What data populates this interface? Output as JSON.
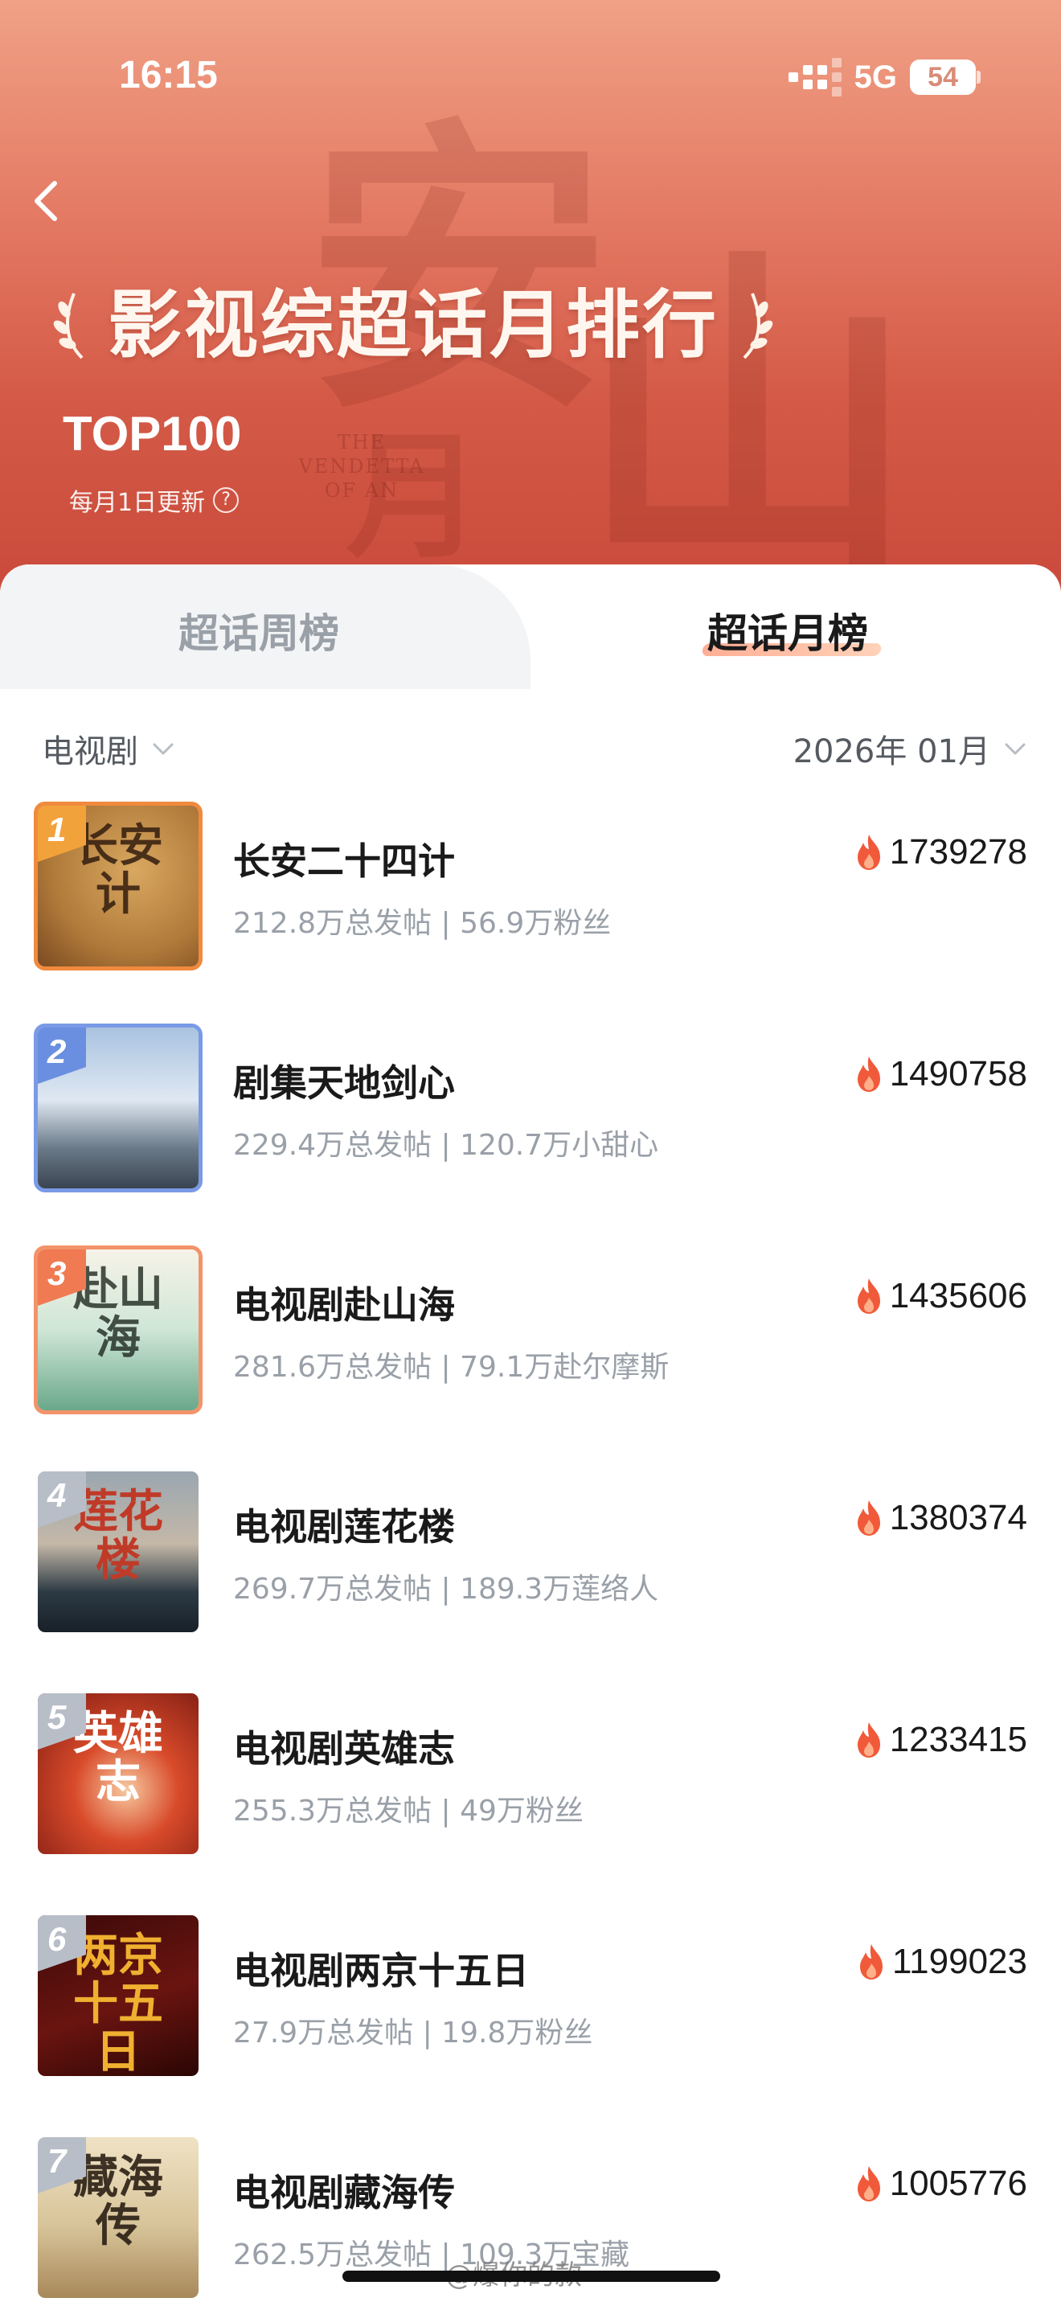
{
  "status_bar": {
    "time": "16:15",
    "network": "5G",
    "battery": "54"
  },
  "header": {
    "title": "影视综超话月排行",
    "top_label": "TOP100",
    "update_note": "每月1日更新",
    "background_glyphs": [
      "安",
      "山",
      "月"
    ],
    "background_text": "THE VENDETTA OF AN"
  },
  "tabs": [
    {
      "label": "超话周榜",
      "active": false
    },
    {
      "label": "超话月榜",
      "active": true
    }
  ],
  "filters": {
    "category": "电视剧",
    "period": "2026年 01月"
  },
  "list": [
    {
      "rank": "1",
      "name": "长安二十四计",
      "stats": "212.8万总发帖 | 56.9万粉丝",
      "score": "1739278",
      "poster_text": "长安计",
      "badge_color": "#f2a23a",
      "border_color": "#f08a3e"
    },
    {
      "rank": "2",
      "name": "剧集天地剑心",
      "stats": "229.4万总发帖 | 120.7万小甜心",
      "score": "1490758",
      "poster_text": "",
      "badge_color": "#6a8fe0",
      "border_color": "#7a9ae6"
    },
    {
      "rank": "3",
      "name": "电视剧赴山海",
      "stats": "281.6万总发帖 | 79.1万赴尔摩斯",
      "score": "1435606",
      "poster_text": "赴山海",
      "badge_color": "#f07a52",
      "border_color": "#f3936a"
    },
    {
      "rank": "4",
      "name": "电视剧莲花楼",
      "stats": "269.7万总发帖 | 189.3万莲络人",
      "score": "1380374",
      "poster_text": "莲花楼",
      "badge_color": "#b8bec8",
      "border_color": "#ffffff"
    },
    {
      "rank": "5",
      "name": "电视剧英雄志",
      "stats": "255.3万总发帖 | 49万粉丝",
      "score": "1233415",
      "poster_text": "英雄志",
      "badge_color": "#b8bec8",
      "border_color": "#ffffff"
    },
    {
      "rank": "6",
      "name": "电视剧两京十五日",
      "stats": "27.9万总发帖 | 19.8万粉丝",
      "score": "1199023",
      "poster_text": "两京十五日",
      "badge_color": "#b8bec8",
      "border_color": "#ffffff"
    },
    {
      "rank": "7",
      "name": "电视剧藏海传",
      "stats": "262.5万总发帖 | 109.3万宝藏",
      "score": "1005776",
      "poster_text": "藏海传",
      "badge_color": "#b8bec8",
      "border_color": "#ffffff"
    }
  ],
  "watermark": "@爆你的款",
  "colors": {
    "accent": "#f05a3a",
    "header_top": "#f0a186",
    "header_bottom": "#c9493a"
  }
}
